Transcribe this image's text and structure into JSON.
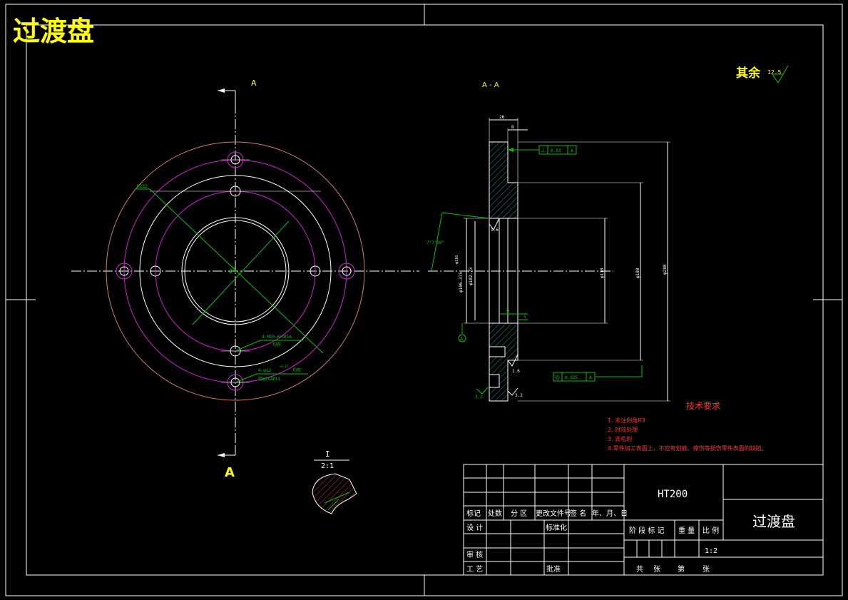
{
  "title": "过渡盘",
  "roughness_note": {
    "label": "其余",
    "value": "12.5"
  },
  "front_view": {
    "section_mark_top": "A",
    "section_mark_bottom": "A",
    "dim_diameter": "R232",
    "dim_center": "φ65",
    "callout_tapped": {
      "line1": "4-M10-6H深16",
      "line2": "均布"
    },
    "callout_counterbore": {
      "line1": "4-φ12",
      "line1_tol": "+0.12",
      "line1_suffix": "均布",
      "line2": "锪φ20深11"
    }
  },
  "section_view": {
    "title": "A - A",
    "dim_top_width": "26",
    "dim_top_step": "8",
    "dim_small_step": "9",
    "dim_small_step2": "5",
    "angle": "7°7'30\"",
    "dia_left_1": "φ106.375",
    "dia_left_2": "φ110",
    "dia_left_3": "φ102.73",
    "dia_bore": "φ110",
    "dia_mid": "φ180",
    "dia_outer": "φ280",
    "tol_perpendicular": {
      "symbol": "⊥",
      "value": "0.02",
      "datum": "A"
    },
    "tol_concentric": {
      "symbol": "◎",
      "value": "0.025",
      "datum": "A"
    },
    "datum_label": "A",
    "roughness_1": "1.6",
    "roughness_2": "1.6",
    "roughness_3": "3.2",
    "roughness_4": "3.2"
  },
  "detail_view": {
    "label": "I",
    "scale": "2:1"
  },
  "technical_requirements": {
    "heading": "技术要求",
    "items": [
      "1. 未注倒角R3",
      "2. 时效处理",
      "3. 去毛刺",
      "4.零件加工表面上，不应有划痕、擦伤等损伤零件表面的缺陷。"
    ]
  },
  "title_block": {
    "material": "HT200",
    "part_name": "过渡盘",
    "scale": "1:2",
    "labels": {
      "mark": "标记",
      "count": "处数",
      "zone": "分 区",
      "change_doc": "更改文件号",
      "signature": "签 名",
      "date": "年、月、日",
      "design": "设 计",
      "standardize": "标准化",
      "review": "审 核",
      "process": "工 艺",
      "approve": "批准",
      "stage_mark": "阶 段 标 记",
      "weight": "重 量",
      "ratio": "比 例",
      "total": "共",
      "sheets": "张",
      "page": "第",
      "sheet2": "张"
    }
  },
  "colors": {
    "background": "#000000",
    "frame": "#ffffff",
    "title": "#ffff00",
    "magenta": "#d020d0",
    "dimension": "#00c000",
    "hatch": "#00a0a0",
    "outer_circle": "#d08060",
    "red_text": "#ff3030"
  }
}
